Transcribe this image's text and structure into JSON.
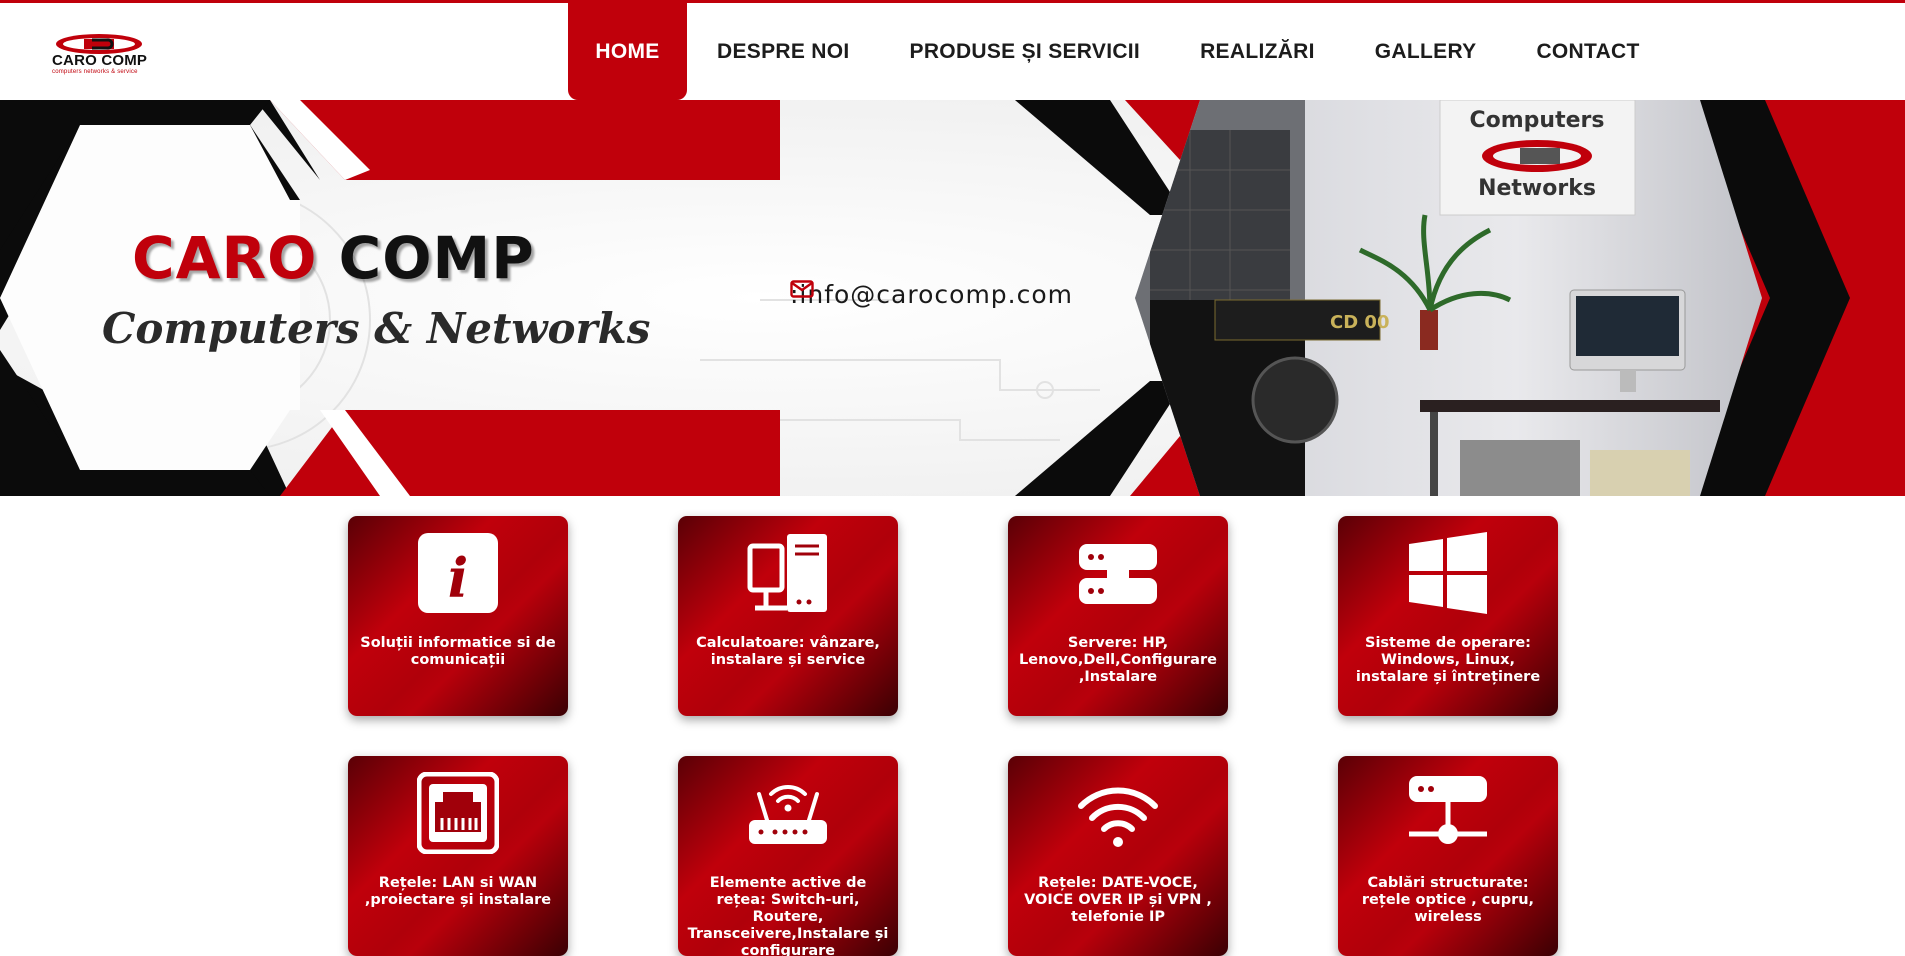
{
  "brand": {
    "logo_name": "CARO COMP",
    "logo_tagline": "computers networks & service",
    "title_part1": "CARO",
    "title_part2": "COMP",
    "subtitle": "Computers & Networks"
  },
  "nav": {
    "items": [
      {
        "label": "HOME",
        "active": true
      },
      {
        "label": "DESPRE NOI",
        "active": false
      },
      {
        "label": "PRODUSE ȘI SERVICII",
        "active": false
      },
      {
        "label": "REALIZĂRI",
        "active": false
      },
      {
        "label": "GALLERY",
        "active": false
      },
      {
        "label": "CONTACT",
        "active": false
      }
    ]
  },
  "banner": {
    "email_text": ":info@carocomp.com",
    "email_icon": "envelope-icon",
    "photo_sign_line1": "Computers",
    "photo_sign_line2": "Networks"
  },
  "services": [
    {
      "icon": "info-icon",
      "label": "Soluții informatice si de comunicații"
    },
    {
      "icon": "desktop-computer-icon",
      "label": "Calculatoare: vânzare, instalare și service"
    },
    {
      "icon": "server-icon",
      "label": "Servere: HP, Lenovo,Dell,Configurare ,Instalare"
    },
    {
      "icon": "windows-icon",
      "label": "Sisteme de operare: Windows, Linux, instalare și întreținere"
    },
    {
      "icon": "ethernet-port-icon",
      "label": "Rețele: LAN si WAN ,proiectare și instalare"
    },
    {
      "icon": "router-icon",
      "label": "Elemente active de rețea: Switch-uri, Routere, Transceivere,Instalare și configurare"
    },
    {
      "icon": "wifi-icon",
      "label": "Rețele: DATE-VOCE, VOICE OVER IP și VPN , telefonie IP"
    },
    {
      "icon": "network-cabling-icon",
      "label": "Cablări structurate: rețele optice , cupru, wireless"
    }
  ],
  "colors": {
    "accent": "#c0000b",
    "dark": "#111111"
  }
}
